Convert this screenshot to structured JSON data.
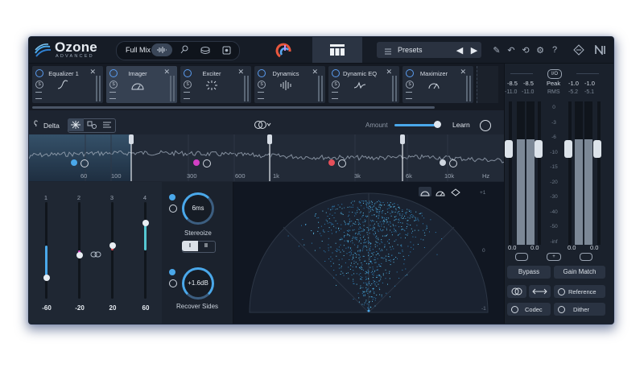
{
  "header": {
    "app_name": "Ozone",
    "app_edition": "ADVANCED",
    "mix_label": "Full Mix",
    "presets_label": "Presets"
  },
  "modules": [
    {
      "name": "Equalizer 1",
      "active": false
    },
    {
      "name": "Imager",
      "active": true
    },
    {
      "name": "Exciter",
      "active": false
    },
    {
      "name": "Dynamics",
      "active": false
    },
    {
      "name": "Dynamic EQ",
      "active": false
    },
    {
      "name": "Maximizer",
      "active": false
    }
  ],
  "controls": {
    "delta_label": "Delta",
    "amount_label": "Amount",
    "amount_value": 0.96,
    "learn_label": "Learn"
  },
  "spectrum": {
    "freq_labels": [
      "60",
      "100",
      "300",
      "600",
      "1k",
      "3k",
      "6k",
      "10k",
      "Hz"
    ]
  },
  "bands": [
    {
      "number": "1",
      "value_label": "-60",
      "level": 0.22,
      "color": "#4aa8ea"
    },
    {
      "number": "2",
      "value_label": "-20",
      "level": 0.45,
      "color": "#d23fc4"
    },
    {
      "number": "3",
      "value_label": "20",
      "level": 0.55,
      "color": "#e6505a"
    },
    {
      "number": "4",
      "value_label": "60",
      "level": 0.78,
      "color": "#55c7d2"
    }
  ],
  "width_controls": {
    "stereoize_value": "6ms",
    "stereoize_label": "Stereoize",
    "mode_options": [
      "I",
      "II"
    ],
    "recover_value": "+1.6dB",
    "recover_label": "Recover Sides"
  },
  "scope_scale": {
    "top": "+1",
    "middle": "0",
    "bottom": "-1"
  },
  "meters": {
    "input_peak_l": "-8.5",
    "input_peak_r": "-8.5",
    "input_rms_l": "-11.0",
    "input_rms_r": "-11.0",
    "peak_label": "Peak",
    "rms_label": "RMS",
    "io_label": "I/O",
    "output_peak_l": "-1.0",
    "output_peak_r": "-1.0",
    "output_rms_l": "-5.2",
    "output_rms_r": "-5.1",
    "scale": [
      "0",
      "-3",
      "-6",
      "-10",
      "-15",
      "-20",
      "-30",
      "-40",
      "-50",
      "-inf"
    ],
    "input_gain": "0.0",
    "output_gain": "0.0",
    "bypass_label": "Bypass",
    "gain_match_label": "Gain Match",
    "reference_label": "Reference",
    "codec_label": "Codec",
    "dither_label": "Dither"
  }
}
